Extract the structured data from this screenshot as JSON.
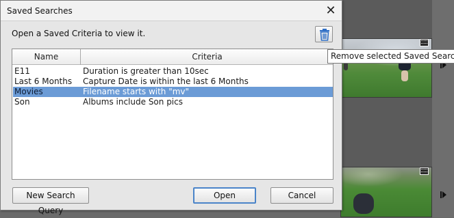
{
  "dialog": {
    "title": "Saved Searches",
    "instruction": "Open a Saved Criteria to view it.",
    "close_symbol": "✕",
    "delete_icon": "trash-icon"
  },
  "table": {
    "columns": [
      "Name",
      "Criteria"
    ],
    "rows": [
      {
        "name": "E11",
        "criteria": "Duration is greater than 10sec",
        "selected": false
      },
      {
        "name": "Last 6 Months",
        "criteria": "Capture Date is within the last 6 Months",
        "selected": false
      },
      {
        "name": "Movies",
        "criteria": "Filename starts with \"mv\"",
        "selected": true
      },
      {
        "name": "Son",
        "criteria": "Albums include Son pics",
        "selected": false
      }
    ]
  },
  "buttons": {
    "new_query": "New Search Query",
    "open": "Open",
    "cancel": "Cancel"
  },
  "tooltip": {
    "text": "Remove selected Saved Search"
  },
  "colors": {
    "selection": "#6b9bd6",
    "delete_icon": "#2f6fc6",
    "default_button_border": "#4a84c9"
  }
}
